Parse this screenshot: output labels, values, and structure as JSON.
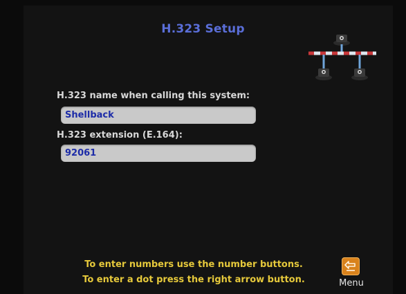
{
  "screen": {
    "title": "H.323 Setup"
  },
  "icons": {
    "network": "h323-network-icon",
    "menu": "menu-back-arrow-icon"
  },
  "fields": {
    "name": {
      "label": "H.323 name when calling this system:",
      "value": "Shellback"
    },
    "extension": {
      "label": "H.323 extension (E.164):",
      "value": "92061"
    }
  },
  "hints": {
    "line1": "To enter numbers use the number buttons.",
    "line2": "To enter a dot press the right arrow button."
  },
  "menu": {
    "label": "Menu"
  },
  "colors": {
    "title": "#5a6ed8",
    "field_bg": "#c9c9c9",
    "field_text": "#1d2ca8",
    "hint_text": "#e6c93b",
    "menu_button": "#d9821c"
  }
}
